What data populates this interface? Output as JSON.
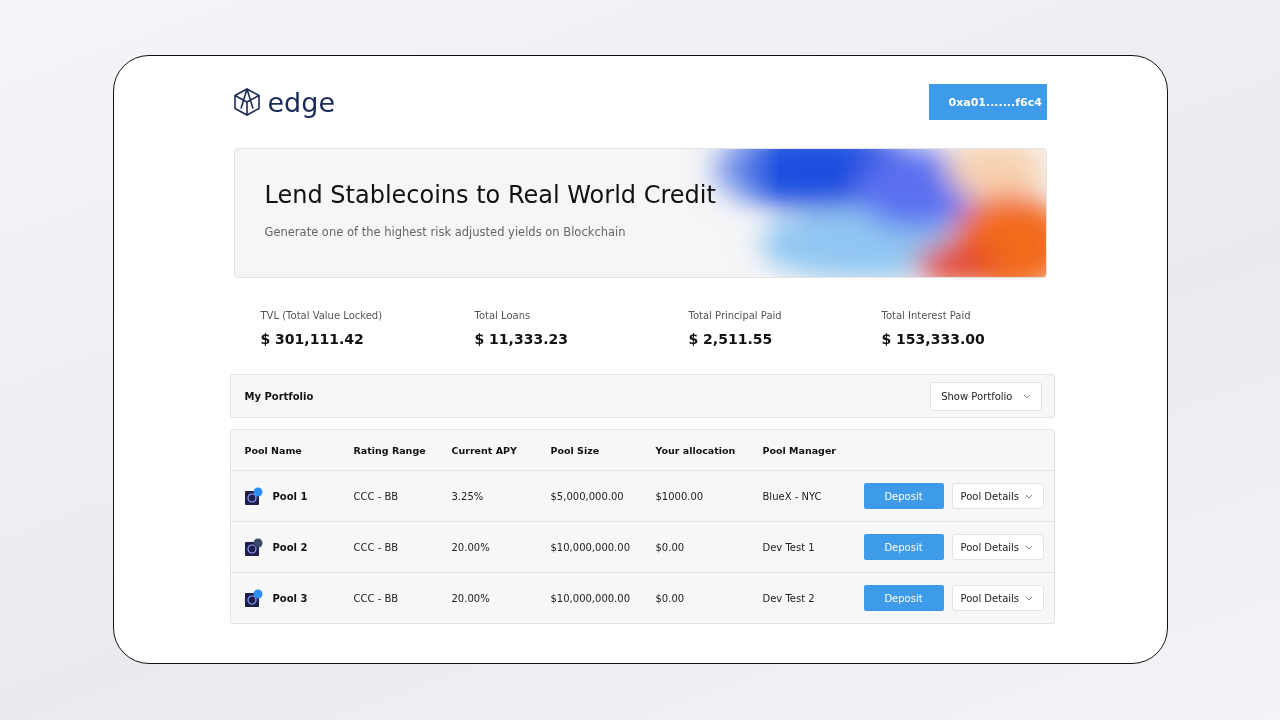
{
  "brand": {
    "name": "edge"
  },
  "wallet": {
    "address": "0xa01.......f6c4"
  },
  "hero": {
    "title": "Lend Stablecoins to Real World Credit",
    "subtitle": "Generate one of the highest risk adjusted yields on Blockchain"
  },
  "stats": [
    {
      "label": "TVL (Total Value Locked)",
      "value": "$ 301,111.42"
    },
    {
      "label": "Total Loans",
      "value": "$ 11,333.23"
    },
    {
      "label": "Total Principal Paid",
      "value": "$ 2,511.55"
    },
    {
      "label": "Total Interest Paid",
      "value": "$ 153,333.00"
    }
  ],
  "portfolio": {
    "title": "My Portfolio",
    "dropdown": "Show Portfolio"
  },
  "table": {
    "columns": [
      "Pool Name",
      "Rating Range",
      "Current APY",
      "Pool Size",
      "Your allocation",
      "Pool Manager"
    ],
    "rows": [
      {
        "name": "Pool 1",
        "color": "#2f8ff0",
        "rating": "CCC - BB",
        "apy": "3.25%",
        "size": "$5,000,000.00",
        "allocation": "$1000.00",
        "manager": "BlueX - NYC",
        "action": "Deposit",
        "details": "Pool Details"
      },
      {
        "name": "Pool 2",
        "color": "#3a4a66",
        "rating": "CCC - BB",
        "apy": "20.00%",
        "size": "$10,000,000.00",
        "allocation": "$0.00",
        "manager": "Dev Test 1",
        "action": "Deposit",
        "details": "Pool Details"
      },
      {
        "name": "Pool 3",
        "color": "#2f8ff0",
        "rating": "CCC - BB",
        "apy": "20.00%",
        "size": "$10,000,000.00",
        "allocation": "$0.00",
        "manager": "Dev Test 2",
        "action": "Deposit",
        "details": "Pool Details"
      }
    ]
  }
}
